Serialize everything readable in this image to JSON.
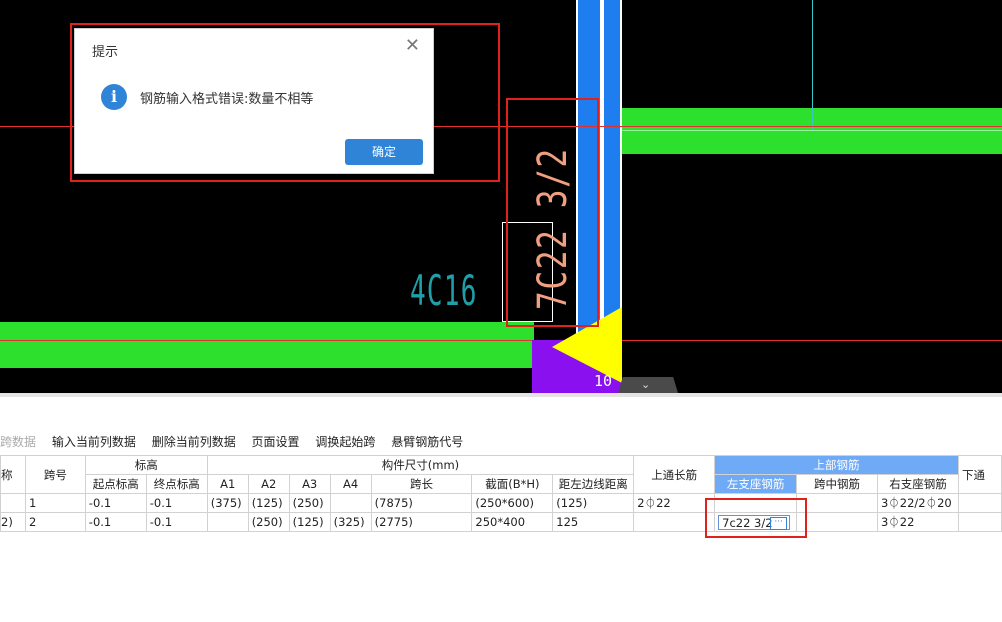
{
  "cad": {
    "rebar_label": "7C22 3/2",
    "beam_label": "4C16",
    "node_number": "10",
    "colors": {
      "beam": "#2ee02e",
      "column": "#1e7ef0",
      "background": "#000000",
      "axis": "#e23030"
    }
  },
  "dialog": {
    "title": "提示",
    "message": "钢筋输入格式错误:数量不相等",
    "ok_label": "确定"
  },
  "toolbar": {
    "items": [
      "跨数据",
      "输入当前列数据",
      "删除当前列数据",
      "页面设置",
      "调换起始跨",
      "悬臂钢筋代号"
    ]
  },
  "table": {
    "group_headers": {
      "name": "称",
      "span": "跨号",
      "elevation": "标高",
      "dims": "构件尺寸(mm)",
      "top_through": "上通长筋",
      "top_rebar": "上部钢筋",
      "bottom": "下通"
    },
    "sub_headers": {
      "start_elev": "起点标高",
      "end_elev": "终点标高",
      "a1": "A1",
      "a2": "A2",
      "a3": "A3",
      "a4": "A4",
      "span_len": "跨长",
      "section": "截面(B*H)",
      "offset": "距左边线距离",
      "left_support": "左支座钢筋",
      "mid_span": "跨中钢筋",
      "right_support": "右支座钢筋"
    },
    "rows": [
      {
        "name": "",
        "span": "1",
        "start": "-0.1",
        "end": "-0.1",
        "a1": "(375)",
        "a2": "(125)",
        "a3": "(250)",
        "a4": "",
        "len": "(7875)",
        "section": "(250*600)",
        "offset": "(125)",
        "through": "2⏀22",
        "left": "",
        "mid": "",
        "right": "3⏀22/2⏀20"
      },
      {
        "name": "2)",
        "span": "2",
        "start": "-0.1",
        "end": "-0.1",
        "a1": "",
        "a2": "(250)",
        "a3": "(125)",
        "a4": "(325)",
        "len": "(2775)",
        "section": "250*400",
        "offset": "125",
        "through": "",
        "left": "7c22 3/2",
        "mid": "",
        "right": "3⏀22"
      }
    ]
  }
}
